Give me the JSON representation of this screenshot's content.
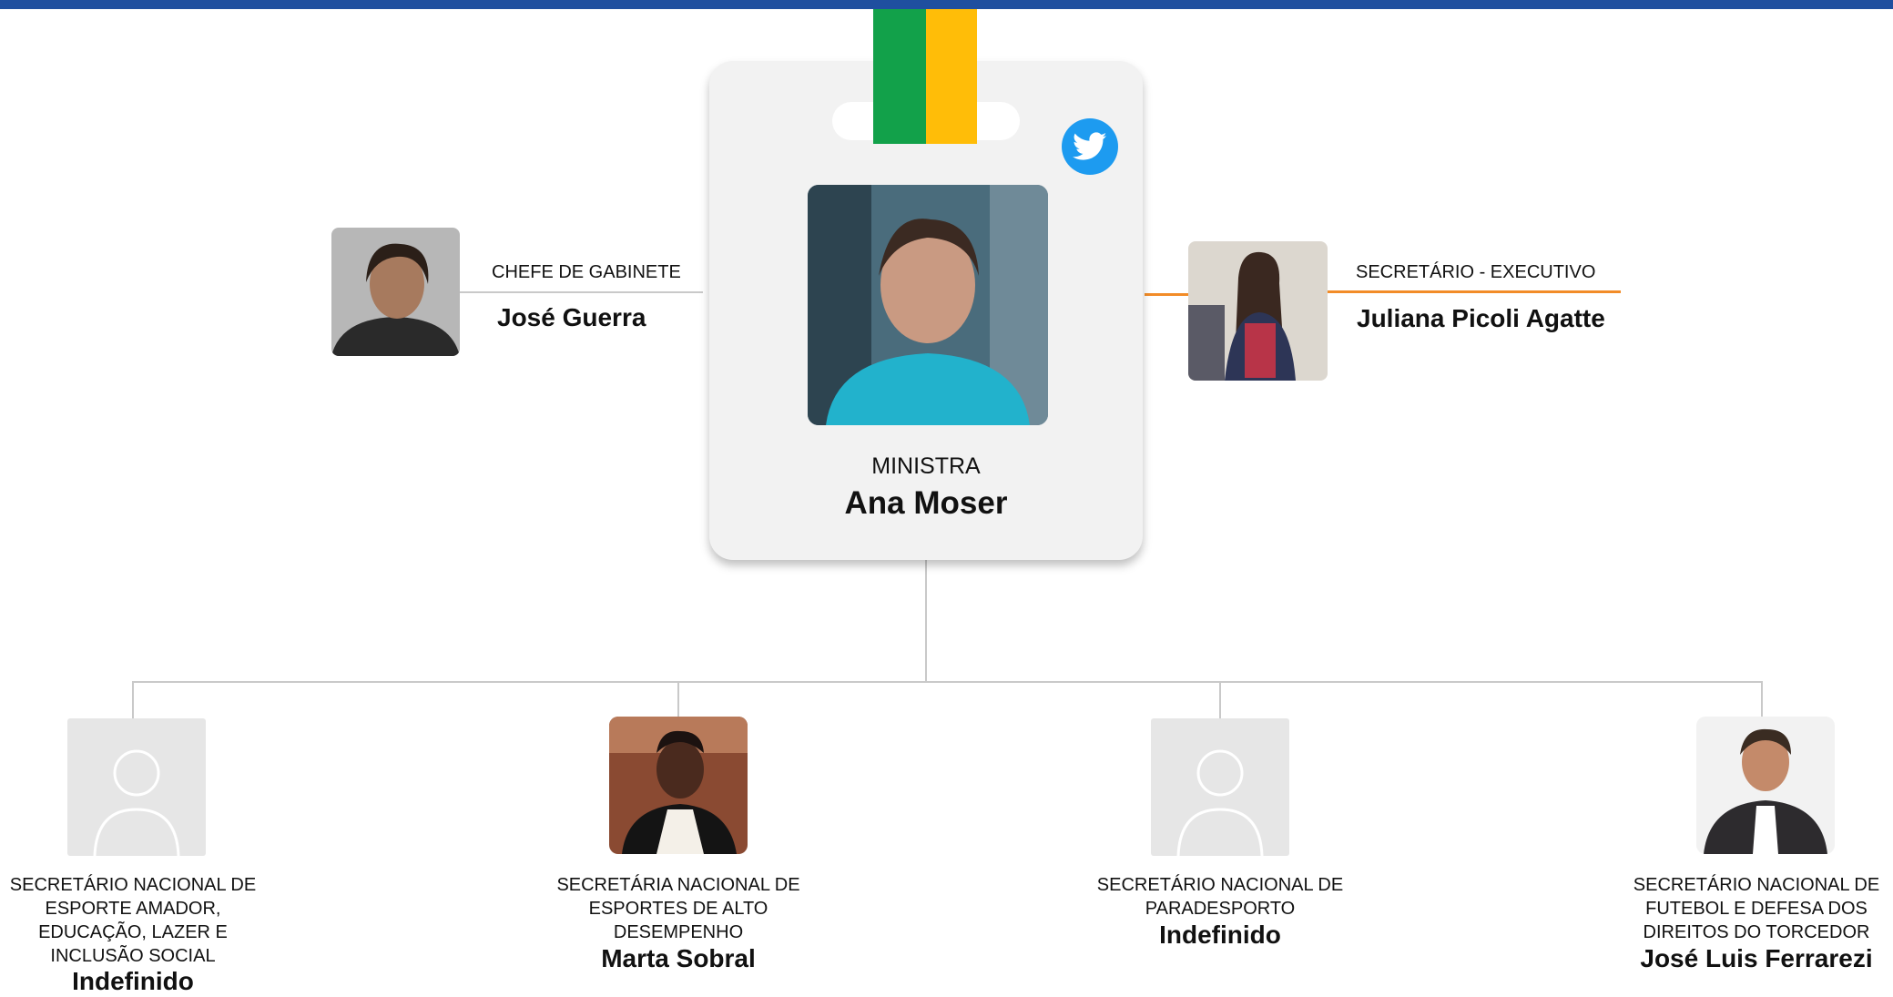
{
  "colors": {
    "topbar": "#1f4f9f",
    "connector": "#c9c9c9",
    "accent_orange": "#f28c28",
    "flag_green": "#12a14a",
    "flag_yellow": "#ffbd08",
    "twitter_blue": "#1d9bf0"
  },
  "minister": {
    "role": "MINISTRA",
    "name": "Ana Moser",
    "social_icon": "twitter-icon"
  },
  "chief_of_staff": {
    "role": "CHEFE DE GABINETE",
    "name": "José Guerra"
  },
  "executive_secretary": {
    "role": "SECRETÁRIO - EXECUTIVO",
    "name": "Juliana Picoli Agatte"
  },
  "secretaries": [
    {
      "role_lines": [
        "SECRETÁRIO NACIONAL DE",
        "ESPORTE AMADOR,",
        "EDUCAÇÃO, LAZER E",
        "INCLUSÃO SOCIAL"
      ],
      "name": "Indefinido",
      "photo": "placeholder-avatar-icon"
    },
    {
      "role_lines": [
        "SECRETÁRIA NACIONAL DE",
        "ESPORTES DE ALTO",
        "DESEMPENHO"
      ],
      "name": "Marta Sobral",
      "photo": "photo"
    },
    {
      "role_lines": [
        "SECRETÁRIO NACIONAL DE",
        "PARADESPORTO"
      ],
      "name": "Indefinido",
      "photo": "placeholder-avatar-icon"
    },
    {
      "role_lines": [
        "SECRETÁRIO NACIONAL DE",
        "FUTEBOL E DEFESA DOS",
        "DIREITOS DO TORCEDOR"
      ],
      "name": "José Luis Ferrarezi",
      "photo": "photo"
    }
  ]
}
